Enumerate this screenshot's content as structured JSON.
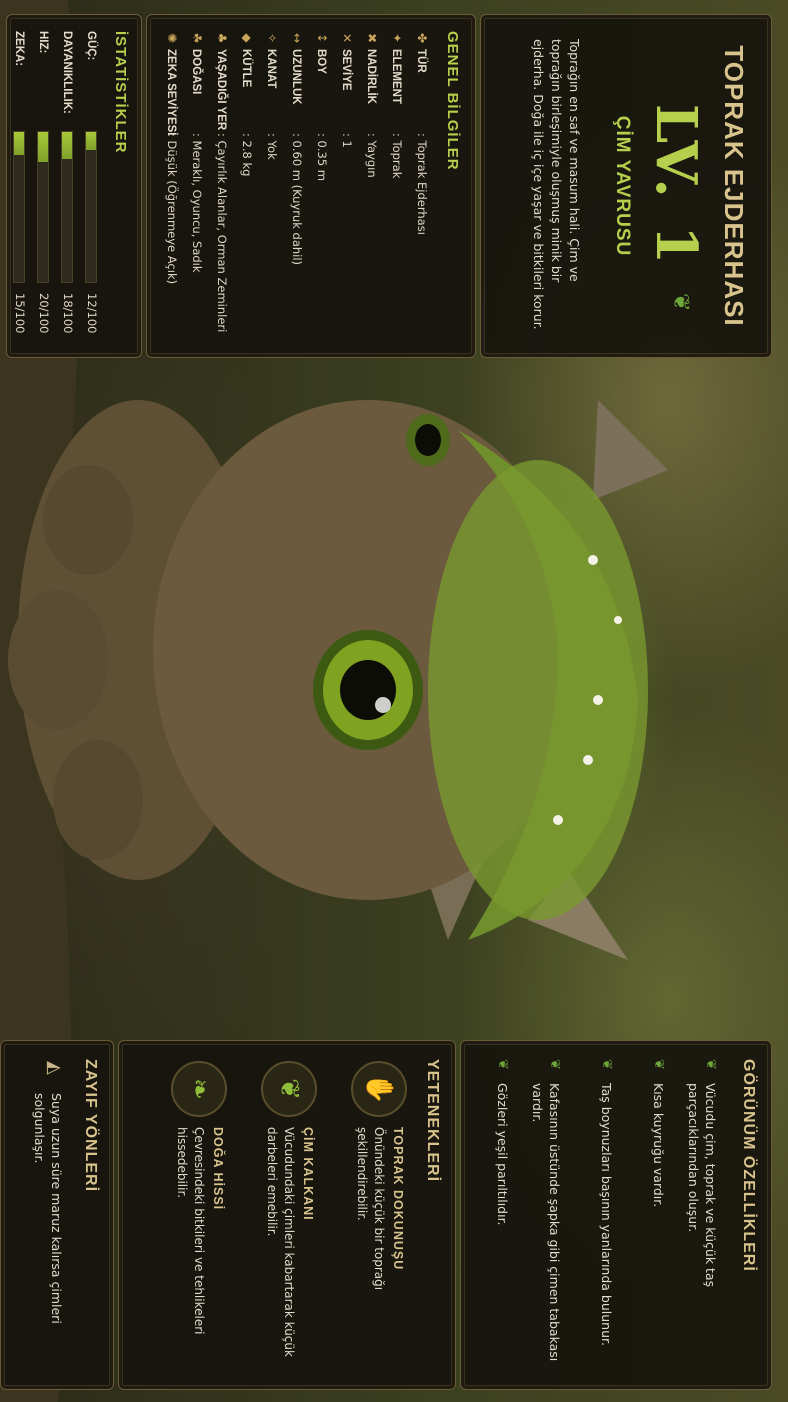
{
  "card": {
    "title": "TOPRAK EJDERHASI",
    "level": "LV. 1",
    "subtitle": "ÇİM YAVRUSU",
    "description": "Toprağın en saf ve masum hali. Çim ve toprağın birleşimiyle oluşmuş minik bir ejderha. Doğa ile iç içe yaşar ve bitkileri korur."
  },
  "general": {
    "header": "GENEL BİLGİLER",
    "rows": [
      {
        "icon": "claw-icon",
        "label": "TÜR",
        "value": ": Toprak Ejderhası"
      },
      {
        "icon": "element-icon",
        "label": "ELEMENT",
        "value": ": Toprak"
      },
      {
        "icon": "rarity-icon",
        "label": "NADİRLİK",
        "value": ": Yaygın"
      },
      {
        "icon": "level-icon",
        "label": "SEVİYE",
        "value": ": 1"
      },
      {
        "icon": "height-icon",
        "label": "BOY",
        "value": ": 0.35 m"
      },
      {
        "icon": "length-icon",
        "label": "UZUNLUK",
        "value": ": 0.60 m (Kuyruk dahil)"
      },
      {
        "icon": "wing-icon",
        "label": "KANAT",
        "value": ": Yok"
      },
      {
        "icon": "weight-icon",
        "label": "KÜTLE",
        "value": ": 2.8 kg"
      },
      {
        "icon": "habitat-icon",
        "label": "YAŞADIĞI YER",
        "value": ": Çayırlık Alanlar, Orman Zeminleri"
      },
      {
        "icon": "nature-icon",
        "label": "DOĞASI",
        "value": ": Meraklı, Oyuncu, Sadık"
      },
      {
        "icon": "brain-icon",
        "label": "ZEKA SEVİYESİ",
        "value": ": Düşük (Öğrenmeye Açık)"
      }
    ]
  },
  "stats": {
    "header": "İSTATİSTİKLER",
    "items": [
      {
        "label": "GÜÇ:",
        "value": 12,
        "max": 100,
        "text": "12/100"
      },
      {
        "label": "DAYANIKLILIK:",
        "value": 18,
        "max": 100,
        "text": "18/100"
      },
      {
        "label": "HIZ:",
        "value": 20,
        "max": 100,
        "text": "20/100"
      },
      {
        "label": "ZEKA:",
        "value": 15,
        "max": 100,
        "text": "15/100"
      }
    ]
  },
  "appearance": {
    "header": "GÖRÜNÜM ÖZELLİKLERİ",
    "items": [
      "Vücudu çim, toprak ve küçük taş parçacıklarından oluşur.",
      "Kısa kuyruğu vardır.",
      "Taş boynuzları başının yanlarında bulunur.",
      "Kafasının üstünde şapka gibi çimen tabakası vardır.",
      "Gözleri yeşil parıltılıdır."
    ]
  },
  "abilities": {
    "header": "YETENEKLERİ",
    "items": [
      {
        "icon": "earth-hand-icon",
        "name": "TOPRAK DOKUNUŞU",
        "desc": "Önündeki küçük bir toprağı şekillendirebilir."
      },
      {
        "icon": "grass-shield-icon",
        "name": "ÇİM KALKANI",
        "desc": "Vücudundaki çimleri kabartarak küçük darbeleri emebilir."
      },
      {
        "icon": "leaf-sense-icon",
        "name": "DOĞA HİSSİ",
        "desc": "Çevresindeki bitkileri ve tehlikeleri hissedebilir."
      }
    ]
  },
  "weakness": {
    "header": "ZAYIF YÖNLERİ",
    "items": [
      {
        "icon": "water-drop-icon",
        "text": "Suya uzun süre maruz kalırsa çimleri solgunlaşır."
      }
    ]
  },
  "colors": {
    "accent": "#b6cf4c",
    "gold": "#d8c48c",
    "panel": "#16130d"
  }
}
